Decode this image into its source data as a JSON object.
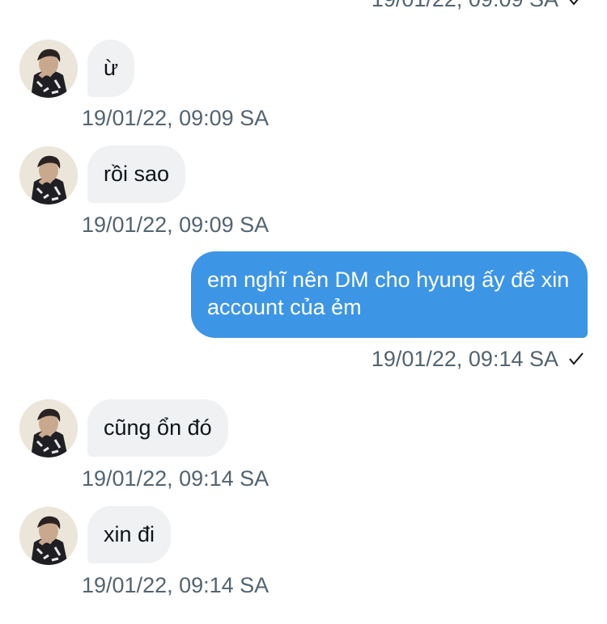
{
  "messages": [
    {
      "side": "out",
      "text": "",
      "timestamp": "19/01/22, 09:09 SA"
    },
    {
      "side": "in",
      "text": "ừ",
      "timestamp": "19/01/22, 09:09 SA"
    },
    {
      "side": "in",
      "text": "rồi sao",
      "timestamp": "19/01/22, 09:09 SA"
    },
    {
      "side": "out",
      "text": "em nghĩ nên DM cho hyung ấy để xin account của ẻm",
      "timestamp": "19/01/22, 09:14 SA"
    },
    {
      "side": "in",
      "text": "cũng ổn đó",
      "timestamp": "19/01/22, 09:14 SA"
    },
    {
      "side": "in",
      "text": "xin đi",
      "timestamp": "19/01/22, 09:14 SA"
    }
  ],
  "colors": {
    "outgoing_bubble": "#3d95e6",
    "incoming_bubble": "#eff1f3",
    "timestamp": "#536471"
  },
  "icons": {
    "read_receipt": "check-icon",
    "avatar": "avatar"
  }
}
